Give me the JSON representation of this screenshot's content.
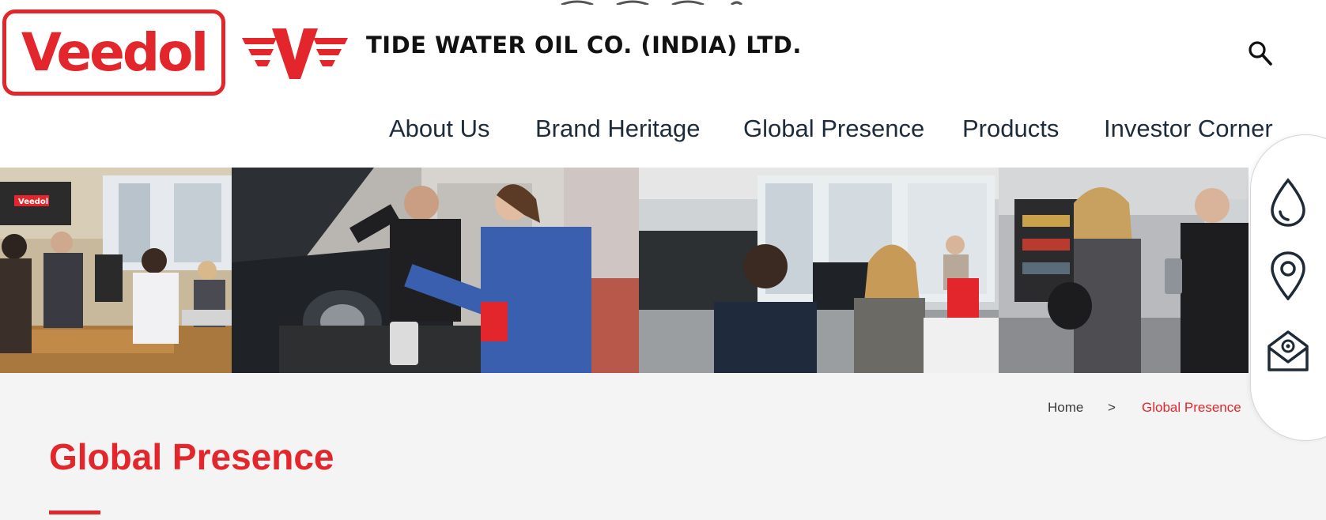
{
  "brand": {
    "logo_text": "Veedol",
    "company_name": "TIDE WATER OIL CO. (INDIA) LTD.",
    "accent_color": "#e3262b"
  },
  "header": {
    "search_icon": "search-icon"
  },
  "nav": {
    "items": [
      {
        "label": "About Us"
      },
      {
        "label": "Brand Heritage"
      },
      {
        "label": "Global Presence"
      },
      {
        "label": "Products"
      },
      {
        "label": "Investor Corner"
      }
    ]
  },
  "side_rail": {
    "icons": [
      "oil-drop-icon",
      "location-pin-icon",
      "email-envelope-icon"
    ]
  },
  "breadcrumb": {
    "home": "Home",
    "separator": ">",
    "current": "Global Presence"
  },
  "page": {
    "title": "Global Presence"
  },
  "banner": {
    "logo_sign_text": "Veedol"
  }
}
